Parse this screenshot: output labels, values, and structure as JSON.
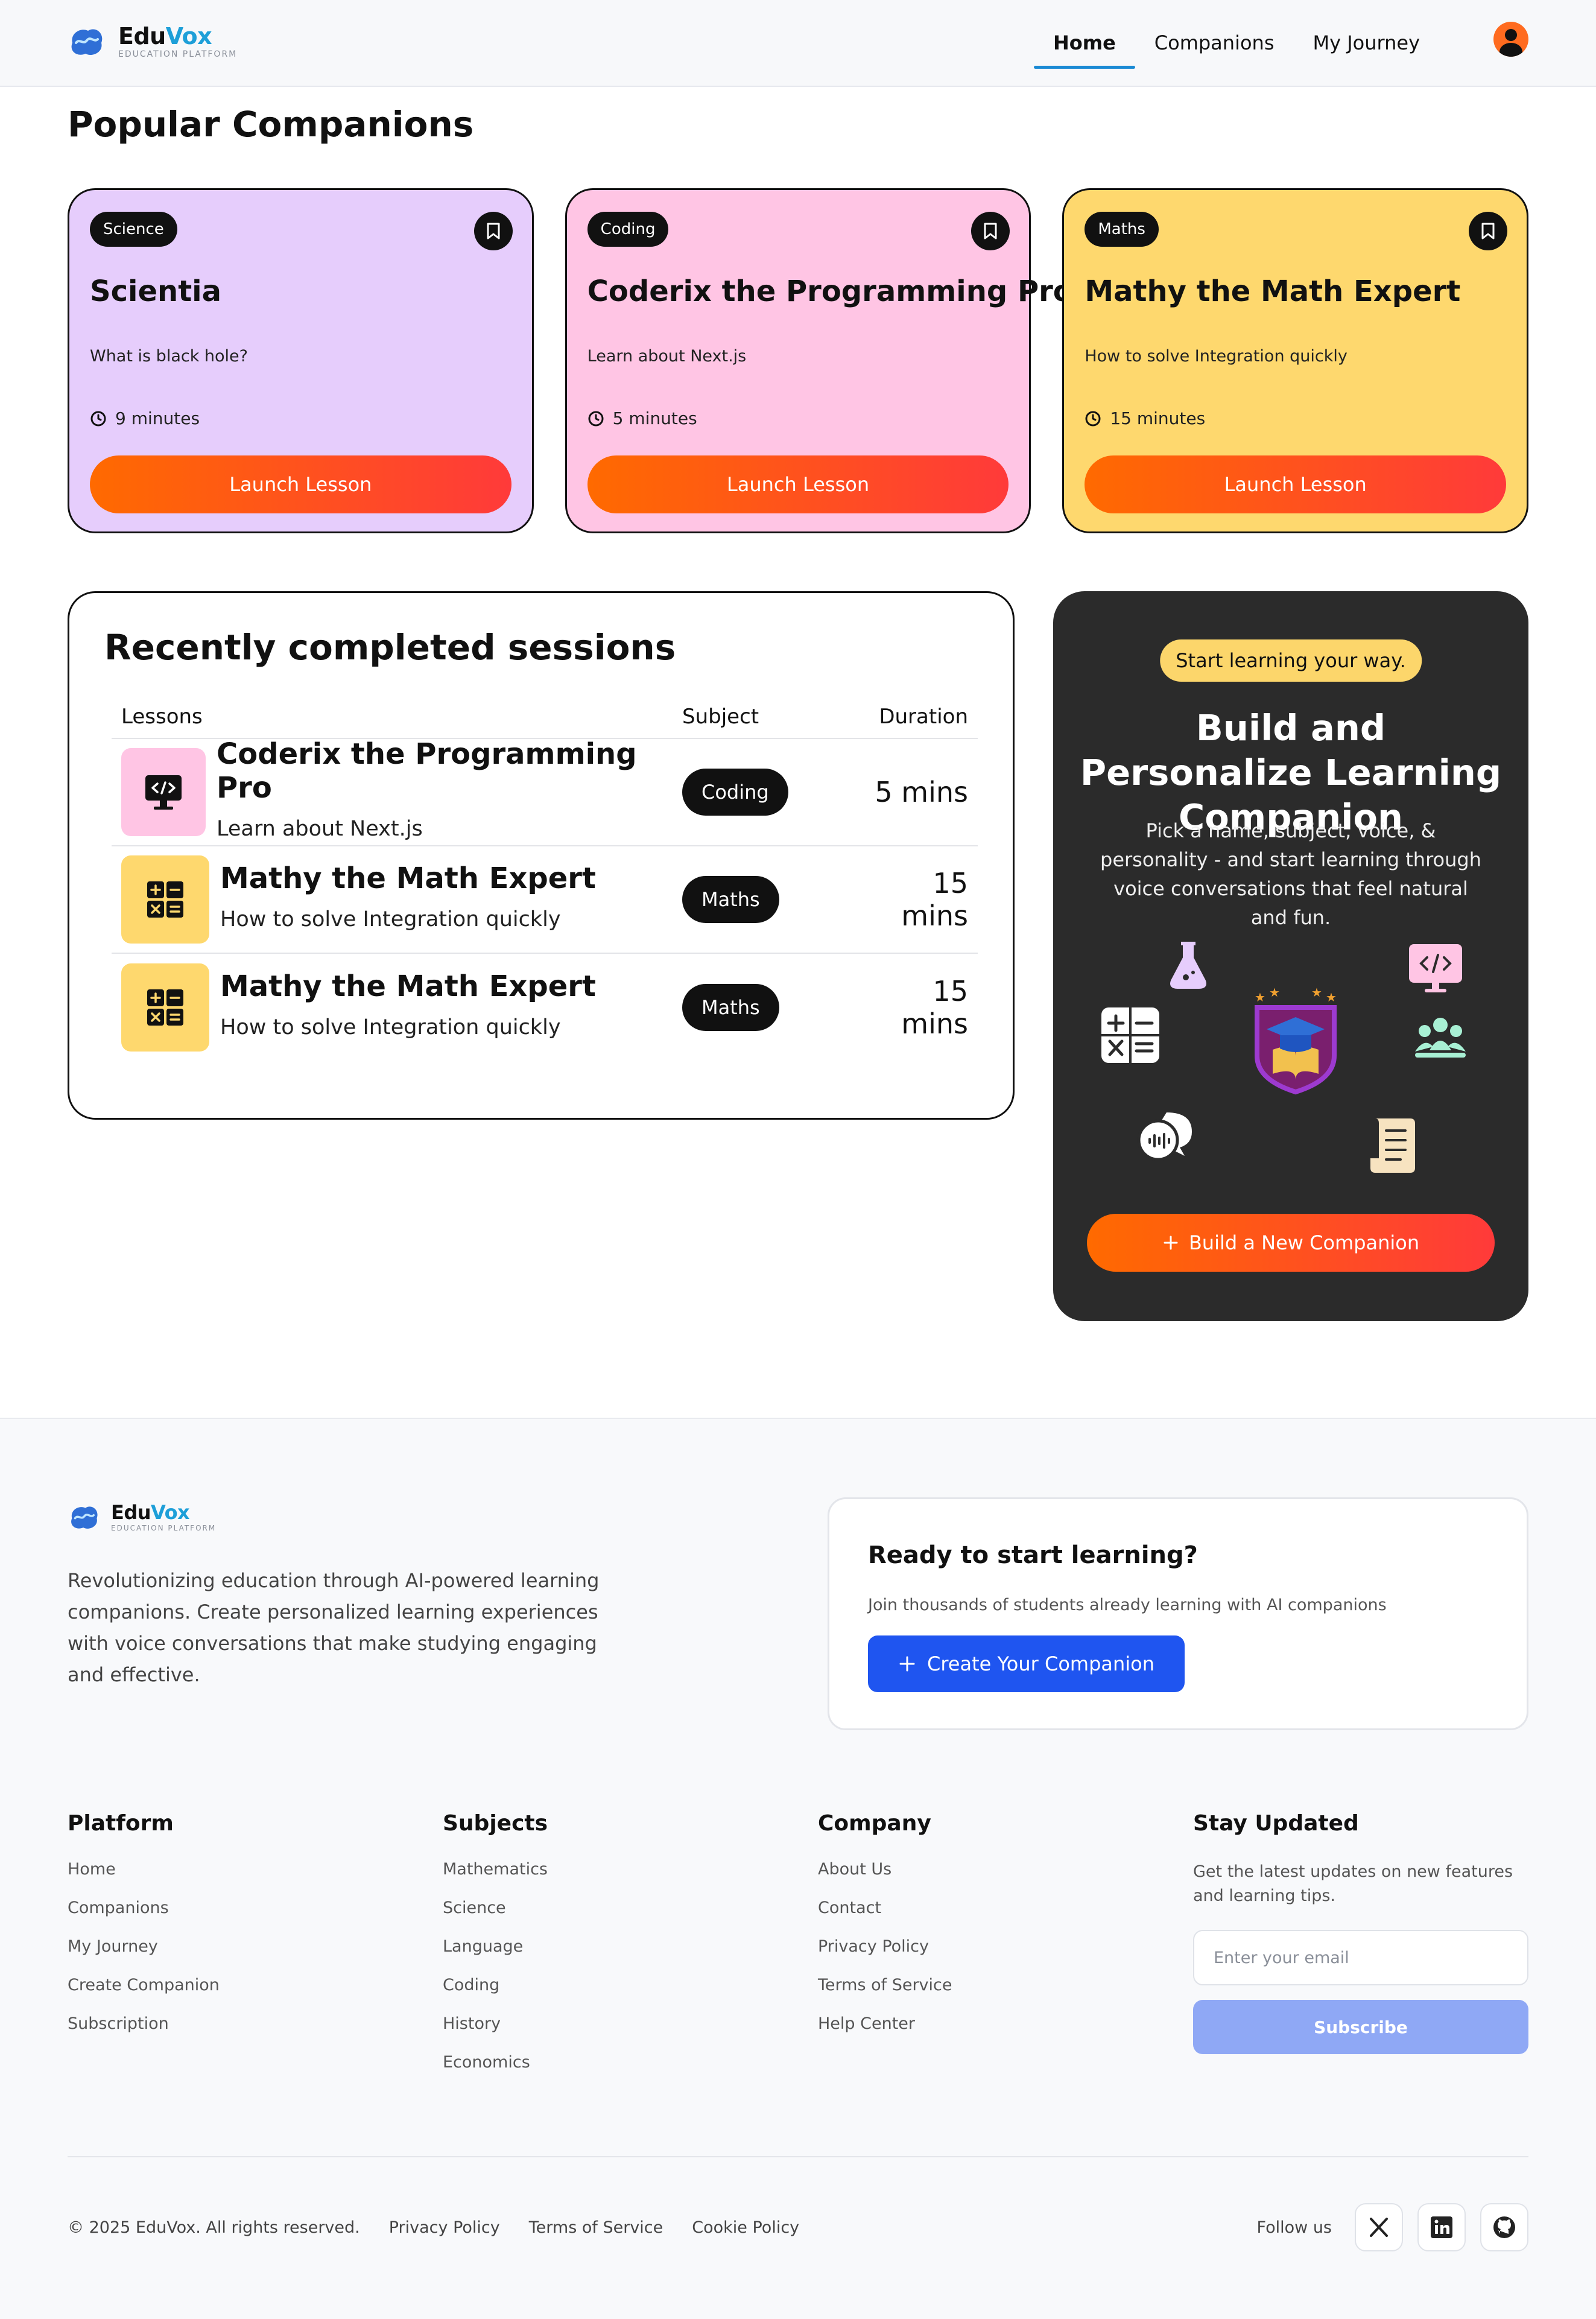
{
  "brand": {
    "name_part1": "Edu",
    "name_part2": "Vox",
    "tagline": "EDUCATION PLATFORM"
  },
  "nav": {
    "links": [
      {
        "label": "Home",
        "active": true
      },
      {
        "label": "Companions",
        "active": false
      },
      {
        "label": "My Journey",
        "active": false
      }
    ],
    "avatar_icon": "user-avatar-icon"
  },
  "popular": {
    "title": "Popular Companions",
    "cards": [
      {
        "subject": "Science",
        "title": "Scientia",
        "topic": "What is black hole?",
        "duration": "9 minutes",
        "button": "Launch Lesson",
        "color": "#e6cdfc"
      },
      {
        "subject": "Coding",
        "title": "Coderix the Programming Pro",
        "topic": "Learn about Next.js",
        "duration": "5 minutes",
        "button": "Launch Lesson",
        "color": "#ffc5e4"
      },
      {
        "subject": "Maths",
        "title": "Mathy the Math Expert",
        "topic": "How to solve Integration quickly",
        "duration": "15 minutes",
        "button": "Launch Lesson",
        "color": "#fed86e"
      }
    ]
  },
  "sessions": {
    "title": "Recently completed sessions",
    "columns": [
      "Lessons",
      "Subject",
      "Duration"
    ],
    "rows": [
      {
        "name": "Coderix the Programming Pro",
        "topic": "Learn about Next.js",
        "subject": "Coding",
        "duration": "5 mins",
        "icon": "code-monitor-icon",
        "color": "#ffc5e4"
      },
      {
        "name": "Mathy the Math Expert",
        "topic": "How to solve Integration quickly",
        "subject": "Maths",
        "duration": "15 mins",
        "icon": "calculator-icon",
        "color": "#fed86e"
      },
      {
        "name": "Mathy the Math Expert",
        "topic": "How to solve Integration quickly",
        "subject": "Maths",
        "duration": "15 mins",
        "icon": "calculator-icon",
        "color": "#fed86e"
      }
    ]
  },
  "build": {
    "tag": "Start learning your way.",
    "title": "Build and Personalize Learning Companion",
    "description": "Pick a name, subject, voice, & personality - and start learning through voice conversations that feel natural and fun.",
    "button": "Build a New Companion"
  },
  "footer": {
    "about": "Revolutionizing education through AI-powered learning companions. Create personalized learning experiences with voice conversations that make studying engaging and effective.",
    "cta": {
      "title": "Ready to start learning?",
      "description": "Join thousands of students already learning with AI companions",
      "button": "Create Your Companion"
    },
    "columns": [
      {
        "title": "Platform",
        "links": [
          "Home",
          "Companions",
          "My Journey",
          "Create Companion",
          "Subscription"
        ]
      },
      {
        "title": "Subjects",
        "links": [
          "Mathematics",
          "Science",
          "Language",
          "Coding",
          "History",
          "Economics"
        ]
      },
      {
        "title": "Company",
        "links": [
          "About Us",
          "Contact",
          "Privacy Policy",
          "Terms of Service",
          "Help Center"
        ]
      }
    ],
    "newsletter": {
      "title": "Stay Updated",
      "description": "Get the latest updates on new features and learning tips.",
      "placeholder": "Enter your email",
      "button": "Subscribe"
    },
    "copyright": "© 2025 EduVox. All rights reserved.",
    "legal_links": [
      "Privacy Policy",
      "Terms of Service",
      "Cookie Policy"
    ],
    "follow_label": "Follow us",
    "social": [
      "x-icon",
      "linkedin-icon",
      "github-icon"
    ]
  }
}
